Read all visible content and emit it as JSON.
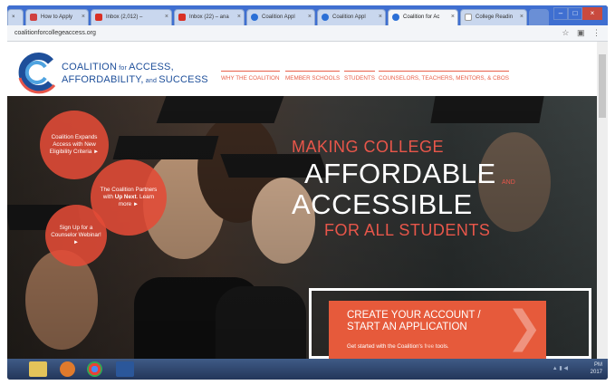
{
  "browser": {
    "tabs": [
      {
        "label": "×",
        "color": "#999999"
      },
      {
        "label": "How to Apply",
        "color": "#d04040"
      },
      {
        "label": "Inbox (2,012) –",
        "color": "#d93025"
      },
      {
        "label": "Inbox (22) – ana",
        "color": "#d93025"
      },
      {
        "label": "Coalition Appl",
        "color": "#2b6fd6"
      },
      {
        "label": "Coalition Appl",
        "color": "#2b6fd6"
      },
      {
        "label": "Coalition for Ac",
        "color": "#2b6fd6"
      },
      {
        "label": "College Readin",
        "color": "#bbbbbb"
      }
    ],
    "active_tab_index": 6,
    "tab_close": "×",
    "url": "coalitionforcollegeaccess.org",
    "star_icon": "☆",
    "ext_icon": "▣",
    "menu_icon": "⋮"
  },
  "site": {
    "logo_line1": "COALITION",
    "logo_line1_small": " for ",
    "logo_line1_end": "ACCESS,",
    "logo_line2": "AFFORDABILITY,",
    "logo_line2_small": " and ",
    "logo_line2_end": "SUCCESS",
    "nav": [
      "WHY THE COALITION",
      "MEMBER SCHOOLS",
      "STUDENTS",
      "COUNSELORS, TEACHERS, MENTORS, & CBOS"
    ]
  },
  "hero": {
    "bubbles": [
      {
        "text": "Coalition Expands Access with New Eligibility Criteria ►"
      },
      {
        "pre": "The Coalition Partners with ",
        "bold": "Up Next",
        "post": ". Learn more ►"
      },
      {
        "text": "Sign Up for a Counselor Webinar! ►"
      }
    ],
    "headline_1": "MAKING COLLEGE",
    "headline_2": "AFFORDABLE",
    "headline_and": "AND",
    "headline_3": "ACCESSIBLE",
    "headline_4": "FOR ALL STUDENTS",
    "cta_title": "CREATE YOUR ACCOUNT / START AN APPLICATION",
    "cta_sub_pre": "Get started with the Coalition's ",
    "cta_sub_free": "free",
    "cta_sub_post": " tools.",
    "cta_arrow": "❯"
  },
  "taskbar": {
    "clock_time": "PM",
    "clock_date": "2017",
    "tray": "▲ ▮ ◀"
  },
  "colors": {
    "accent": "#e65a3b",
    "brand_blue": "#1e4f9a"
  }
}
